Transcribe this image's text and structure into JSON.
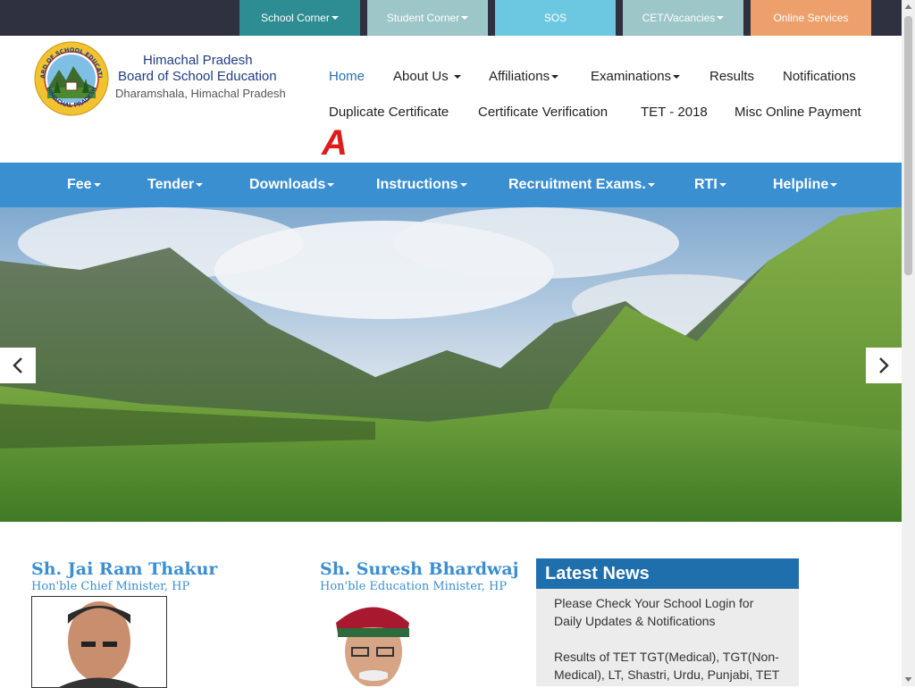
{
  "topbar": {
    "items": [
      {
        "label": "School Corner",
        "dropdown": true,
        "color": "#2d8d92"
      },
      {
        "label": "Student Corner",
        "dropdown": true,
        "color": "#9cc6c8"
      },
      {
        "label": "SOS",
        "dropdown": false,
        "color": "#6cc8e0"
      },
      {
        "label": "CET/Vacancies",
        "dropdown": true,
        "color": "#9cc6c8"
      },
      {
        "label": "Online Services",
        "dropdown": false,
        "color": "#eda06c"
      }
    ]
  },
  "header": {
    "org_line1": "Himachal Pradesh",
    "org_line2": "Board of School Education",
    "org_line3": "Dharamshala, Himachal Pradesh",
    "seal_text_top": "BOARD OF SCHOOL EDUCATION",
    "seal_text_bottom": "HIMACHAL PRADESH",
    "accessibility_glyph": "A"
  },
  "main_nav": {
    "home": "Home",
    "about": "About Us",
    "affiliations": "Affiliations",
    "examinations": "Examinations",
    "results": "Results",
    "notifications": "Notifications",
    "duplicate": "Duplicate Certificate",
    "verification": "Certificate Verification",
    "tet": "TET - 2018",
    "misc": "Misc Online Payment"
  },
  "blue_nav": {
    "fee": "Fee",
    "tender": "Tender",
    "downloads": "Downloads",
    "instructions": "Instructions",
    "recruitment": "Recruitment Exams.",
    "rti": "RTI",
    "helpline": "Helpline"
  },
  "people": [
    {
      "name": "Sh. Jai Ram Thakur",
      "role": "Hon'ble Chief Minister, HP"
    },
    {
      "name": "Sh. Suresh Bhardwaj",
      "role": "Hon'ble Education Minister, HP"
    }
  ],
  "news": {
    "title": "Latest News",
    "items": [
      "Please Check Your School Login for Daily Updates & Notifications",
      "Results of TET TGT(Medical), TGT(Non-Medical), LT, Shastri, Urdu, Punjabi, TET"
    ]
  },
  "colors": {
    "topbar_bg": "#2f3140",
    "blue_nav": "#3a8fd1",
    "news_header": "#1f6fad",
    "accent_text": "#3a8fd1",
    "home_link": "#2a6fa8"
  }
}
